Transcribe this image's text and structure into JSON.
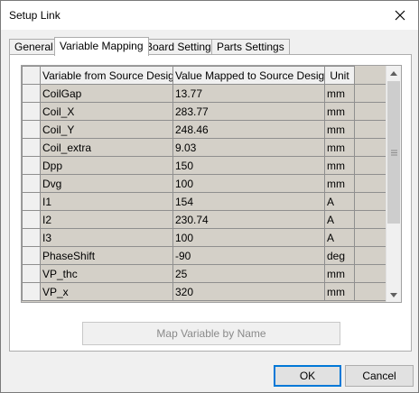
{
  "window": {
    "title": "Setup Link"
  },
  "tabs": [
    {
      "label": "General"
    },
    {
      "label": "Variable Mapping"
    },
    {
      "label": "Board Settings"
    },
    {
      "label": "Parts Settings"
    }
  ],
  "grid": {
    "columns": [
      "Variable from Source Design",
      "Value Mapped to Source Design",
      "Unit"
    ],
    "rows": [
      {
        "variable": "CoilGap",
        "value": "13.77",
        "unit": "mm"
      },
      {
        "variable": "Coil_X",
        "value": "283.77",
        "unit": "mm"
      },
      {
        "variable": "Coil_Y",
        "value": "248.46",
        "unit": "mm"
      },
      {
        "variable": "Coil_extra",
        "value": "9.03",
        "unit": "mm"
      },
      {
        "variable": "Dpp",
        "value": "150",
        "unit": "mm"
      },
      {
        "variable": "Dvg",
        "value": "100",
        "unit": "mm"
      },
      {
        "variable": "I1",
        "value": "154",
        "unit": "A"
      },
      {
        "variable": "I2",
        "value": "230.74",
        "unit": "A"
      },
      {
        "variable": "I3",
        "value": "100",
        "unit": "A"
      },
      {
        "variable": "PhaseShift",
        "value": "-90",
        "unit": "deg"
      },
      {
        "variable": "VP_thc",
        "value": "25",
        "unit": "mm"
      },
      {
        "variable": "VP_x",
        "value": "320",
        "unit": "mm"
      }
    ]
  },
  "buttons": {
    "map_by_name": "Map Variable by Name",
    "ok": "OK",
    "cancel": "Cancel"
  }
}
